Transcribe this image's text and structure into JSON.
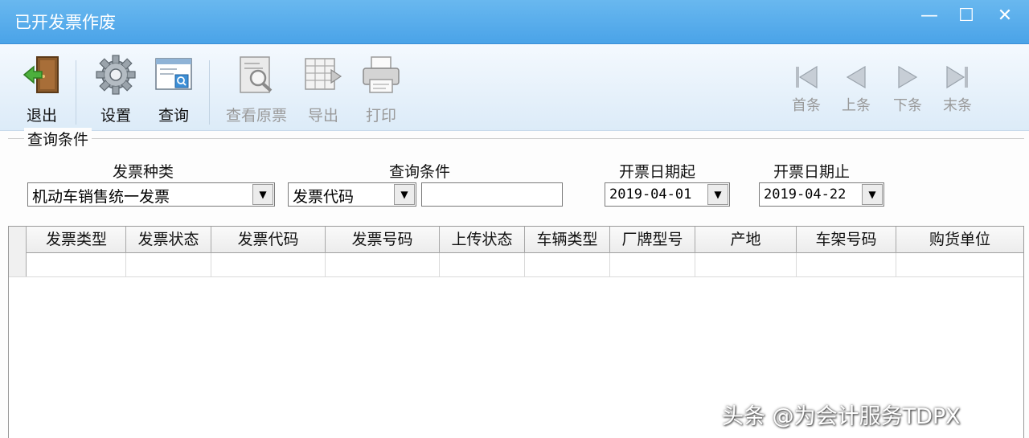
{
  "window": {
    "title": "已开发票作废"
  },
  "toolbar": {
    "exit": "退出",
    "settings": "设置",
    "query": "查询",
    "view_original": "查看原票",
    "export": "导出",
    "print": "打印",
    "first": "首条",
    "prev": "上条",
    "next": "下条",
    "last": "末条"
  },
  "query": {
    "group_title": "查询条件",
    "invoice_type_label": "发票种类",
    "invoice_type_value": "机动车销售统一发票",
    "condition_label": "查询条件",
    "condition_value": "发票代码",
    "condition_text": "",
    "date_from_label": "开票日期起",
    "date_from_value": "2019-04-01",
    "date_to_label": "开票日期止",
    "date_to_value": "2019-04-22"
  },
  "grid": {
    "columns": [
      "发票类型",
      "发票状态",
      "发票代码",
      "发票号码",
      "上传状态",
      "车辆类型",
      "厂牌型号",
      "产地",
      "车架号码",
      "购货单位"
    ]
  },
  "watermark": "头条 @为会计服务TDPX",
  "colors": {
    "titlebar": "#4aa3e8",
    "toolbar": "#dcebf8"
  }
}
